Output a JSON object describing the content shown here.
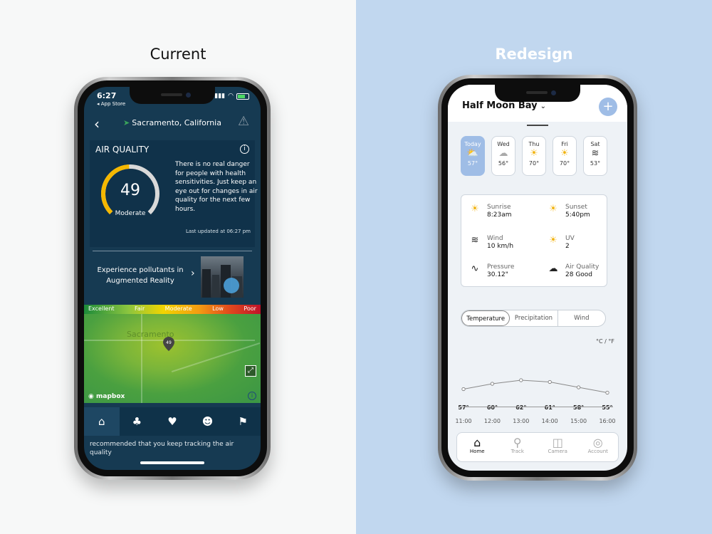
{
  "headings": {
    "current": "Current",
    "redesign": "Redesign"
  },
  "current_app": {
    "status": {
      "time": "6:27",
      "back_app": "◂ App Store"
    },
    "location": "Sacramento, California",
    "air_quality": {
      "title": "AIR QUALITY",
      "value": "49",
      "value_number": 49,
      "value_max": 100,
      "category": "Moderate",
      "description": "There is no real danger for people with health sensitivities. Just keep an eye out for changes in air quality for the next few hours.",
      "updated": "Last updated at 06:27 pm",
      "colors": {
        "gauge": "#f5b800",
        "track": "#d9d9d9"
      }
    },
    "ar": {
      "text": "Experience pollutants in Augmented Reality"
    },
    "map": {
      "legend": [
        "Excellent",
        "Fair",
        "Moderate",
        "Low",
        "Poor"
      ],
      "city": "Sacramento",
      "pin_value": "49",
      "attribution": "mapbox"
    },
    "tabs": [
      "home-icon",
      "tree-icon",
      "heart-icon",
      "people-icon",
      "runner-icon"
    ],
    "tail_text": "recommended that you keep tracking the air quality"
  },
  "redesign_app": {
    "city": "Half Moon Bay",
    "days": [
      {
        "label": "Today",
        "temp": "57°",
        "icon": "partly-cloudy-icon"
      },
      {
        "label": "Wed",
        "temp": "56°",
        "icon": "cloud-icon"
      },
      {
        "label": "Thu",
        "temp": "70°",
        "icon": "sun-icon"
      },
      {
        "label": "Fri",
        "temp": "70°",
        "icon": "sun-icon"
      },
      {
        "label": "Sat",
        "temp": "53°",
        "icon": "wind-icon"
      }
    ],
    "details": [
      {
        "label": "Sunrise",
        "value": "8:23am",
        "icon": "sunrise-icon"
      },
      {
        "label": "Sunset",
        "value": "5:40pm",
        "icon": "sunset-icon"
      },
      {
        "label": "Wind",
        "value": "10 km/h",
        "icon": "wind-icon"
      },
      {
        "label": "UV",
        "value": "2",
        "icon": "sun-icon"
      },
      {
        "label": "Pressure",
        "value": "30.12\"",
        "icon": "pulse-icon"
      },
      {
        "label": "Air Quality",
        "value": "28 Good",
        "icon": "leaf-cloud-icon"
      }
    ],
    "segments": [
      "Temperature",
      "Precipitation",
      "Wind"
    ],
    "units": "°C / °F",
    "chart_data": {
      "type": "line",
      "x": [
        "11:00",
        "12:00",
        "13:00",
        "14:00",
        "15:00",
        "16:00"
      ],
      "values": [
        57,
        60,
        62,
        61,
        58,
        55
      ],
      "labels": [
        "57°",
        "60°",
        "62°",
        "61°",
        "58°",
        "55°"
      ],
      "title": "",
      "xlabel": "",
      "ylabel": ""
    },
    "tabs": [
      {
        "label": "Home",
        "icon": "home-icon"
      },
      {
        "label": "Track",
        "icon": "location-pin-icon"
      },
      {
        "label": "Camera",
        "icon": "camera-icon"
      },
      {
        "label": "Account",
        "icon": "user-icon"
      }
    ]
  }
}
